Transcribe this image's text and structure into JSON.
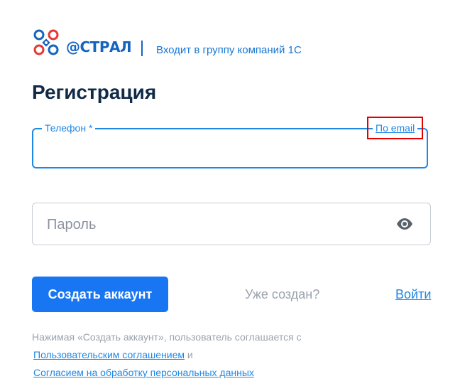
{
  "brand": {
    "name": "@СТРАЛ",
    "tagline": "Входит в группу компаний 1С",
    "logo_icon": "astral-ornament-logo",
    "colors": {
      "primary": "#1976f2",
      "logo_red": "#e53935",
      "logo_blue": "#1565c0"
    }
  },
  "page": {
    "title": "Регистрация"
  },
  "phone": {
    "label": "Телефон *",
    "value": "",
    "switch_link": "По email"
  },
  "password": {
    "placeholder": "Пароль",
    "visibility_icon": "eye-icon"
  },
  "actions": {
    "create_button": "Создать аккаунт",
    "already_text": "Уже создан?",
    "login_link": "Войти"
  },
  "consent": {
    "text": "Нажимая «Создать аккаунт», пользователь соглашается с",
    "agreement_link": "Пользовательским соглашением",
    "and": "и",
    "data_link": "Согласием на обработку персональных данных"
  }
}
